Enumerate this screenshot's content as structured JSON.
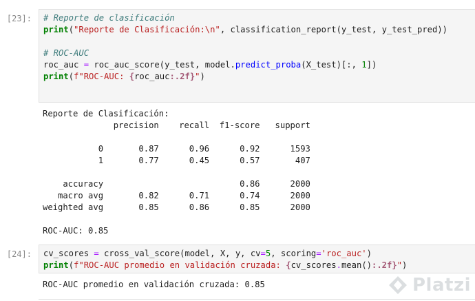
{
  "cells": [
    {
      "prompt": "[23]:",
      "code": {
        "comment_report": "# Reporte de clasificación",
        "print_report": {
          "fn_print": "print",
          "open": "(",
          "str": "\"Reporte de Clasificación:\\n\"",
          "rest": ", classification_report(y_test, y_test_pred))"
        },
        "comment_roc": "# ROC-AUC",
        "roc_assign": {
          "lhs": "roc_auc ",
          "eq": "=",
          "mid": " roc_auc_score(y_test, model.",
          "method": "predict_proba",
          "args": "(X_test)[:, ",
          "num": "1",
          "end": "])"
        },
        "print_roc": {
          "fn_print": "print",
          "open": "(",
          "str_a": "f\"ROC-AUC: ",
          "interp_open": "{",
          "interp_var": "roc_auc",
          "interp_fmt": ":.2f",
          "interp_close": "}",
          "str_b": "\"",
          "close": ")"
        }
      },
      "output_lines": [
        "Reporte de Clasificación:",
        "              precision    recall  f1-score   support",
        "",
        "           0       0.87      0.96      0.92      1593",
        "           1       0.77      0.45      0.57       407",
        "",
        "    accuracy                           0.86      2000",
        "   macro avg       0.82      0.71      0.74      2000",
        "weighted avg       0.85      0.86      0.85      2000",
        "",
        "ROC-AUC: 0.85"
      ]
    },
    {
      "prompt": "[24]:",
      "code": {
        "cv_assign": {
          "lhs": "cv_scores ",
          "eq": "=",
          "mid": " cross_val_score(model, X, y, cv",
          "eq2": "=",
          "num": "5",
          "mid2": ", scoring",
          "eq3": "=",
          "str": "'roc_auc'",
          "end": ")"
        },
        "print_cv": {
          "fn_print": "print",
          "open": "(",
          "str_a": "f\"ROC-AUC promedio en validación cruzada: ",
          "interp_open": "{",
          "interp_var": "cv_scores",
          "interp_dot": ".",
          "interp_method": "mean",
          "interp_paren": "()",
          "interp_fmt": ":.2f",
          "interp_close": "}",
          "str_b": "\"",
          "close": ")"
        }
      },
      "output_lines": [
        "ROC-AUC promedio en validación cruzada: 0.85"
      ]
    }
  ],
  "watermark": {
    "text": "Platzi",
    "icon": "platzi-logo-icon",
    "color": "#9aa3a8"
  },
  "colors": {
    "comment": "#3d7b7b",
    "string": "#ba2121",
    "number": "#008000",
    "function": "#0000ff",
    "operator": "#aa22ff",
    "cell_bg": "#f5f5f5",
    "prompt": "#8a8a8a"
  }
}
